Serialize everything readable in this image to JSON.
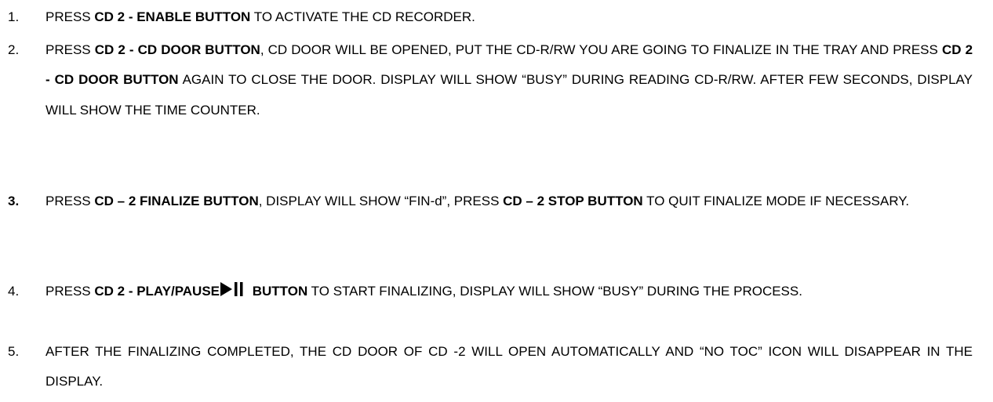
{
  "steps": [
    {
      "number": "1.",
      "parts": [
        {
          "t": "PRESS ",
          "b": false
        },
        {
          "t": "CD 2 - ENABLE BUTTON",
          "b": true
        },
        {
          "t": " TO ACTIVATE THE CD RECORDER.",
          "b": false
        }
      ]
    },
    {
      "number": "2.",
      "parts": [
        {
          "t": "PRESS ",
          "b": false
        },
        {
          "t": "CD 2 - CD DOOR BUTTON",
          "b": true
        },
        {
          "t": ", CD DOOR WILL BE OPENED, PUT THE CD-R/RW YOU ARE GOING TO FINALIZE IN THE TRAY AND PRESS ",
          "b": false
        },
        {
          "t": "CD 2 - CD DOOR BUTTON",
          "b": true
        },
        {
          "t": " AGAIN TO CLOSE THE DOOR. DISPLAY WILL SHOW “BUSY” DURING READING CD-R/RW. AFTER FEW SECONDS, DISPLAY WILL SHOW THE TIME COUNTER.",
          "b": false
        }
      ]
    },
    {
      "number": "3.",
      "number_bold": true,
      "parts": [
        {
          "t": "PRESS ",
          "b": false
        },
        {
          "t": "CD – 2 FINALIZE BUTTON",
          "b": true
        },
        {
          "t": ", DISPLAY WILL SHOW “FIN-d”, PRESS ",
          "b": false
        },
        {
          "t": "CD – 2 STOP BUTTON",
          "b": true
        },
        {
          "t": " TO QUIT FINALIZE MODE IF NECESSARY.",
          "b": false
        }
      ]
    },
    {
      "number": "4.",
      "parts": [
        {
          "t": "PRESS ",
          "b": false
        },
        {
          "t": "CD 2 - PLAY/PAUSE",
          "b": true
        },
        {
          "icon": "play-pause-icon"
        },
        {
          "t": " BUTTON",
          "b": true
        },
        {
          "t": " TO START FINALIZING, DISPLAY WILL SHOW “BUSY” DURING THE PROCESS.",
          "b": false
        }
      ]
    },
    {
      "number": "5.",
      "parts": [
        {
          "t": "AFTER THE FINALIZING COMPLETED, THE CD DOOR OF CD -2 WILL OPEN AUTOMATICALLY AND “NO TOC” ICON WILL DISAPPEAR IN THE DISPLAY.",
          "b": false
        }
      ]
    }
  ]
}
